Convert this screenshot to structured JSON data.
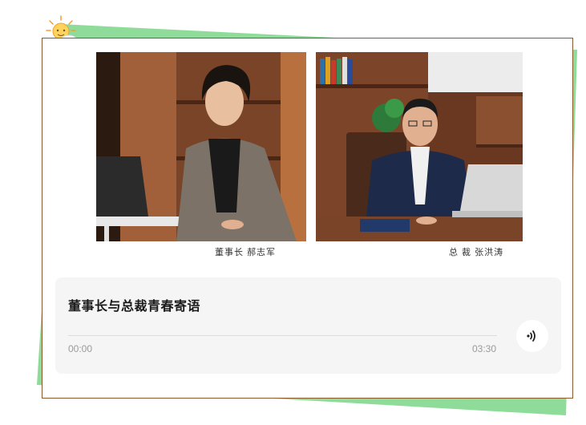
{
  "photos": [
    {
      "caption": "董事长  郝志军"
    },
    {
      "caption": "总 裁  张洪涛"
    }
  ],
  "audio": {
    "title": "董事长与总裁青春寄语",
    "current_time": "00:00",
    "duration": "03:30",
    "progress": 0
  },
  "icons": {
    "decoration": "sun-cloud-icon",
    "play": "sound-wave-icon"
  },
  "colors": {
    "accent_green": "#8fdc9a",
    "card_border": "#8a5a2a",
    "player_bg": "#f5f5f5"
  }
}
